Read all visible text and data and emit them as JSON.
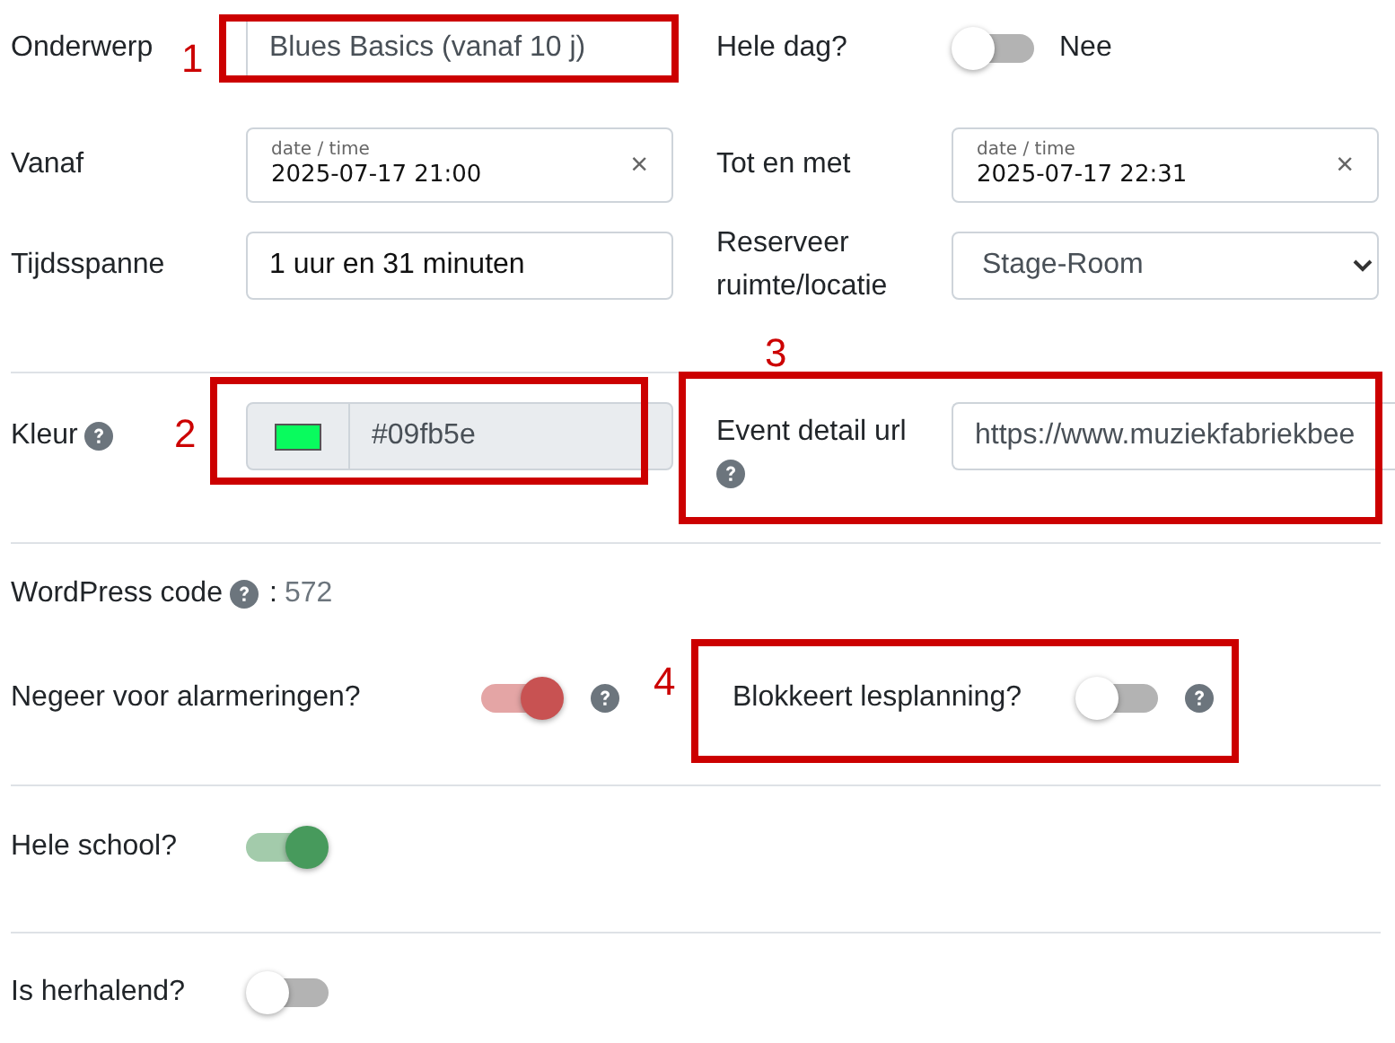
{
  "subject": {
    "label": "Onderwerp",
    "value": "Blues Basics (vanaf 10 j)"
  },
  "all_day": {
    "label": "Hele dag?",
    "on": false,
    "caption": "Nee"
  },
  "from": {
    "label": "Vanaf",
    "hint": "date / time",
    "value": "2025-07-17 21:00",
    "clear": "×"
  },
  "until": {
    "label": "Tot en met",
    "hint": "date / time",
    "value": "2025-07-17 22:31",
    "clear": "×"
  },
  "duration": {
    "label": "Tijdsspanne",
    "value": "1 uur en 31 minuten"
  },
  "room": {
    "label": "Reserveer ruimte/locatie",
    "value": "Stage-Room"
  },
  "colour": {
    "label": "Kleur",
    "color": "#09fb5e",
    "value": "#09fb5e"
  },
  "event_url": {
    "label": "Event detail url",
    "value": "https://www.muziekfabriekbee"
  },
  "wordpress": {
    "label": "WordPress code",
    "separator": ":",
    "value": "572"
  },
  "ignore_alarms": {
    "label": "Negeer voor alarmeringen?",
    "on": true
  },
  "blocks_planning": {
    "label": "Blokkeert lesplanning?",
    "on": false
  },
  "whole_school": {
    "label": "Hele school?",
    "on": true
  },
  "recurring": {
    "label": "Is herhalend?",
    "on": false
  },
  "annotations": [
    {
      "number": "1"
    },
    {
      "number": "2"
    },
    {
      "number": "3"
    },
    {
      "number": "4"
    }
  ]
}
